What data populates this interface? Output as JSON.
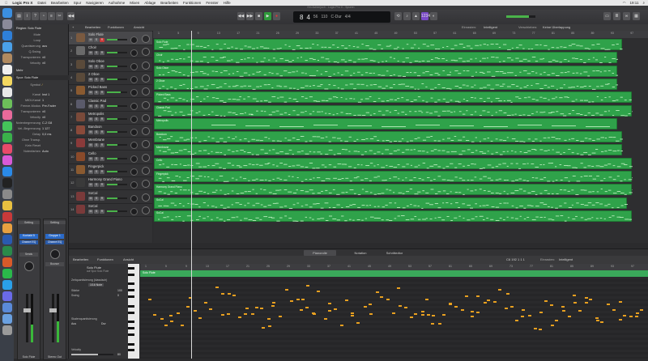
{
  "menubar": {
    "items": [
      "Logic Pro X",
      "Datei",
      "Bearbeiten",
      "Spur",
      "Navigieren",
      "Aufnahme",
      "Mixen",
      "Ablage",
      "Bearbeiten",
      "Funktionen",
      "Fenster",
      "Hilfe"
    ],
    "time": "19:11"
  },
  "window": {
    "title": "Ein Achterjoch - Logic Pro X - Spuren"
  },
  "lcd": {
    "bar": "8",
    "beat": "4",
    "tempo": "110",
    "signature": "4/4",
    "key": "C-Dur",
    "time": "56"
  },
  "inspector": {
    "region_header": "Region: Solo Flute",
    "region_fields": [
      {
        "k": "Mute",
        "v": ""
      },
      {
        "k": "Loop",
        "v": ""
      },
      {
        "k": "Quantisierung",
        "v": "aus"
      },
      {
        "k": "Q-Swing",
        "v": ""
      },
      {
        "k": "Transponieren",
        "v": "±0"
      },
      {
        "k": "Velocity",
        "v": "±0"
      }
    ],
    "more_label": "Mehr",
    "track_header": "Spur: Solo Flute",
    "track_fields": [
      {
        "k": "Symbol",
        "v": ""
      },
      {
        "k": "Kanal",
        "v": "Inst 1"
      },
      {
        "k": "MIDI-Kanal",
        "v": "1"
      },
      {
        "k": "Freeze-Modus",
        "v": "Pre-Fader"
      },
      {
        "k": "Transponieren",
        "v": "±0"
      },
      {
        "k": "Velocity",
        "v": "±0"
      },
      {
        "k": "Notenbegrenzung",
        "v": "C-2  G8"
      },
      {
        "k": "Vel.-Begrenzung",
        "v": "1  127"
      },
      {
        "k": "Delay",
        "v": "0,0 ms"
      },
      {
        "k": "Ohne Transp.",
        "v": ""
      },
      {
        "k": "Kein Reset",
        "v": ""
      },
      {
        "k": "Notenfarben",
        "v": "Auto"
      }
    ],
    "strip_labels": [
      "Setting",
      "Setting",
      "Kontakt 5",
      "Gruppe 1",
      "Channel EQ",
      "Channel EQ",
      "Sends",
      "Bounce",
      "Solo Flute",
      "Stereo Out"
    ]
  },
  "arrange_toolbar": {
    "edit": "Bearbeiten",
    "functions": "Funktionen",
    "view": "Ansicht",
    "snap_label": "Einrasten:",
    "snap": "Intelligent",
    "move_label": "Verschieben:",
    "move": "Keine Überlappung"
  },
  "tracks": [
    {
      "num": "1",
      "name": "Solo Flute",
      "color": "#7a5a40"
    },
    {
      "num": "2",
      "name": "Choir",
      "color": "#6a6a6a"
    },
    {
      "num": "3",
      "name": "Solo Oboe",
      "color": "#5a4a3a"
    },
    {
      "num": "4",
      "name": "2 Oboe",
      "color": "#5a4a3a"
    },
    {
      "num": "5",
      "name": "Picked Bass",
      "color": "#8a5a30"
    },
    {
      "num": "6",
      "name": "Classic Pad",
      "color": "#5a5a6a"
    },
    {
      "num": "7",
      "name": "Metropolis",
      "color": "#7a4a3a"
    },
    {
      "num": "8",
      "name": "Bandoon",
      "color": "#8a4a3a"
    },
    {
      "num": "9",
      "name": "Membrane",
      "color": "#8a3a3a"
    },
    {
      "num": "10",
      "name": "Cello",
      "color": "#8a4a2a"
    },
    {
      "num": "11",
      "name": "Fingerpick",
      "color": "#8a5a30"
    },
    {
      "num": "12",
      "name": "Harmony Grand Piano",
      "color": "#3a3a3a"
    },
    {
      "num": "13",
      "name": "SoCal",
      "color": "#7a3a3a"
    },
    {
      "num": "14",
      "name": "SoCal",
      "color": "#7a3a3a"
    }
  ],
  "ruler_ticks": [
    "1",
    "5",
    "9",
    "13",
    "17",
    "21",
    "25",
    "29",
    "33",
    "37",
    "41",
    "45",
    "49",
    "53",
    "57",
    "61",
    "65",
    "69",
    "73",
    "77",
    "81",
    "85",
    "89",
    "93",
    "97"
  ],
  "lower_tabs": [
    "Pianorolle",
    "Notation",
    "Schrittedtor"
  ],
  "piano": {
    "edit": "Bearbeiten",
    "functions": "Funktionen",
    "view": "Ansicht",
    "track_name": "Solo Flute",
    "track_sub": "auf Spur Solo Flute",
    "quant_label": "Zeitquantisierung (klassisch)",
    "quant_value": "1/16 Note",
    "strength_label": "Stärke",
    "strength_value": "100",
    "swing_label": "Swing",
    "swing_value": "0",
    "scale_label": "Skalenquantisierung",
    "scale_mode": "Aus",
    "scale_key": "Dur",
    "velocity_label": "Velocity",
    "velocity_value": "80",
    "region_label": "Solo Flute",
    "snap_label": "Einrasten:",
    "snap": "Intelligent",
    "position": "C6  192 1 1 1"
  }
}
